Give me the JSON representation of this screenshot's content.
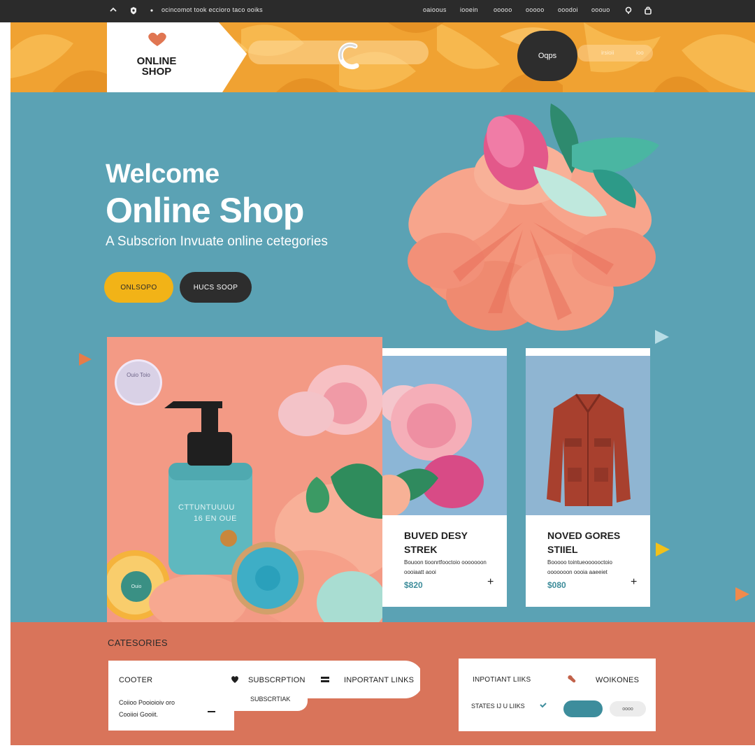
{
  "topbar": {
    "tagline": "ocincomot took eccioro taco ooiks",
    "nav": [
      "oaioous",
      "iooein",
      "ooooo",
      "ooooo",
      "ooodoi",
      "ooouo"
    ]
  },
  "header": {
    "logo_line1": "ONLINE",
    "logo_line2": "SHOP",
    "circle_label": "Oqps",
    "links": [
      "irsioii",
      "ioo"
    ]
  },
  "hero": {
    "welcome": "Welcome",
    "title": "Online Shop",
    "subtitle": "A Subscrion Invuate online cetegories",
    "btn_primary": "ONLSOPO",
    "btn_secondary": "HUCS SOOP",
    "badge": "Ouio Toio",
    "bottle_line1": "CTTUNTUUUU",
    "bottle_line2": "16 EN OUE",
    "orange_badge": "Ouio"
  },
  "cards": [
    {
      "title": "BUVED DESY STREK",
      "desc": "Bouoon tioonrtfooctoio ooooooon oooiaatt aooi",
      "price": "$820"
    },
    {
      "title": "NOVED GORES STIIEL",
      "desc": "Booooo tointueoooooctoio ooooooon oooia aaeeiet",
      "price": "$080"
    }
  ],
  "categories": {
    "title": "CATESORIES",
    "left": {
      "heading": "COOTER",
      "line1": "Coiioo Pooioioiv oro",
      "line2": "Cooiioi Gooiit.",
      "subscription": "SUBSCRPTION",
      "subscription_sub": "SUBSCRTIAK",
      "important": "INPORTANT LINKS"
    },
    "right": {
      "important": "INPOTIANT LIIKS",
      "workones": "WOIKONES",
      "status": "STATES IJ U LIIKS",
      "pill_grey": "oooo"
    }
  },
  "colors": {
    "teal": "#5ba2b4",
    "coral": "#d9745a",
    "yellow": "#f2b317",
    "dark": "#2d2d2d",
    "orange": "#f2a93c"
  }
}
